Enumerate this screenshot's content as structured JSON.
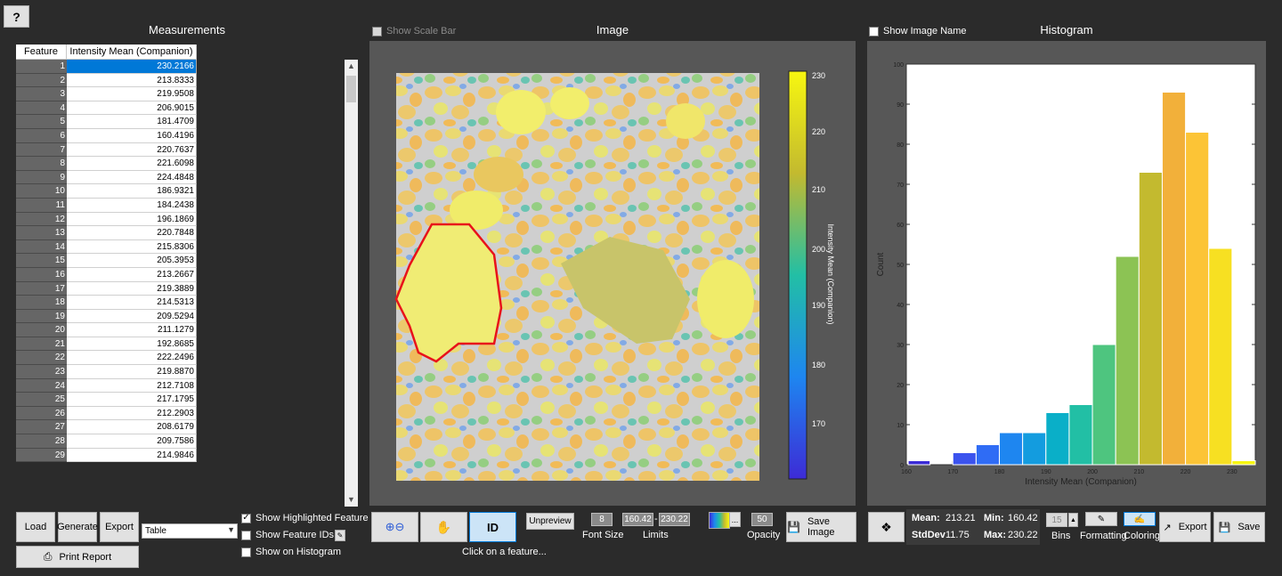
{
  "help_label": "?",
  "measurements": {
    "title": "Measurements",
    "columns": [
      "Feature",
      "Intensity Mean (Companion)"
    ],
    "rows": [
      [
        "1",
        "230.2166"
      ],
      [
        "2",
        "213.8333"
      ],
      [
        "3",
        "219.9508"
      ],
      [
        "4",
        "206.9015"
      ],
      [
        "5",
        "181.4709"
      ],
      [
        "6",
        "160.4196"
      ],
      [
        "7",
        "220.7637"
      ],
      [
        "8",
        "221.6098"
      ],
      [
        "9",
        "224.4848"
      ],
      [
        "10",
        "186.9321"
      ],
      [
        "11",
        "184.2438"
      ],
      [
        "12",
        "196.1869"
      ],
      [
        "13",
        "220.7848"
      ],
      [
        "14",
        "215.8306"
      ],
      [
        "15",
        "205.3953"
      ],
      [
        "16",
        "213.2667"
      ],
      [
        "17",
        "219.3889"
      ],
      [
        "18",
        "214.5313"
      ],
      [
        "19",
        "209.5294"
      ],
      [
        "20",
        "211.1279"
      ],
      [
        "21",
        "192.8685"
      ],
      [
        "22",
        "222.2496"
      ],
      [
        "23",
        "219.8870"
      ],
      [
        "24",
        "212.7108"
      ],
      [
        "25",
        "217.1795"
      ],
      [
        "26",
        "212.2903"
      ],
      [
        "27",
        "208.6179"
      ],
      [
        "28",
        "209.7586"
      ],
      [
        "29",
        "214.9846"
      ]
    ],
    "selected_row": 0,
    "buttons": {
      "load": "Load",
      "generate": "Generate",
      "export": "Export",
      "print_report": "Print Report"
    },
    "output_select": "Table",
    "show_highlighted_feature": "Show Highlighted Feature",
    "show_feature_ids": "Show Feature IDs",
    "show_on_histogram": "Show on Histogram"
  },
  "image": {
    "title": "Image",
    "show_scale_bar": "Show Scale Bar",
    "colorbar_ticks": [
      "230",
      "220",
      "210",
      "200",
      "190",
      "180",
      "170"
    ],
    "colorbar_label": "Intensity Mean (Companion)",
    "unpreview": "Unpreview",
    "font_size_value": "8",
    "font_size_label": "Font Size",
    "limit_min": "160.42",
    "limit_sep": "-",
    "limit_max": "230.22",
    "limits_label": "Limits",
    "colormap_more": "...",
    "opacity_value": "50",
    "opacity_label": "Opacity",
    "save_image": "Save Image",
    "id_label": "ID",
    "hint": "Click on a feature..."
  },
  "histogram": {
    "title": "Histogram",
    "show_image_name": "Show Image Name",
    "mean_label": "Mean:",
    "mean": "213.21",
    "min_label": "Min:",
    "min": "160.42",
    "std_label": "StdDev",
    "std": "11.75",
    "max_label": "Max:",
    "max": "230.22",
    "bins_value": "15",
    "bins_label": "Bins",
    "formatting_label": "Formatting",
    "coloring_label": "Coloring",
    "export": "Export",
    "save": "Save"
  },
  "chart_data": {
    "type": "bar",
    "xlabel": "Intensity Mean (Companion)",
    "ylabel": "Count",
    "xlim": [
      160,
      235
    ],
    "ylim": [
      0,
      100
    ],
    "x_ticks": [
      160,
      170,
      180,
      190,
      200,
      210,
      220,
      230
    ],
    "y_ticks": [
      0,
      10,
      20,
      30,
      40,
      50,
      60,
      70,
      80,
      90,
      100
    ],
    "bins": [
      {
        "start": 160.4,
        "end": 165.1,
        "count": 1,
        "color": "#3b2bd6"
      },
      {
        "start": 170.0,
        "end": 175.0,
        "count": 3,
        "color": "#3b53ee"
      },
      {
        "start": 175.0,
        "end": 180.0,
        "count": 5,
        "color": "#2f6cf5"
      },
      {
        "start": 180.0,
        "end": 185.0,
        "count": 8,
        "color": "#1e86f0"
      },
      {
        "start": 185.0,
        "end": 190.0,
        "count": 8,
        "color": "#139cdf"
      },
      {
        "start": 190.0,
        "end": 195.0,
        "count": 13,
        "color": "#0aafc8"
      },
      {
        "start": 195.0,
        "end": 200.0,
        "count": 15,
        "color": "#22bfa5"
      },
      {
        "start": 200.0,
        "end": 205.0,
        "count": 30,
        "color": "#4ec57f"
      },
      {
        "start": 205.0,
        "end": 210.0,
        "count": 52,
        "color": "#8cc354"
      },
      {
        "start": 210.0,
        "end": 215.0,
        "count": 73,
        "color": "#c3ba2f"
      },
      {
        "start": 215.0,
        "end": 220.0,
        "count": 93,
        "color": "#f2b03a"
      },
      {
        "start": 220.0,
        "end": 225.0,
        "count": 83,
        "color": "#fcc436"
      },
      {
        "start": 225.0,
        "end": 230.0,
        "count": 54,
        "color": "#f7e022"
      },
      {
        "start": 230.0,
        "end": 235.0,
        "count": 1,
        "color": "#f7f710"
      }
    ]
  }
}
